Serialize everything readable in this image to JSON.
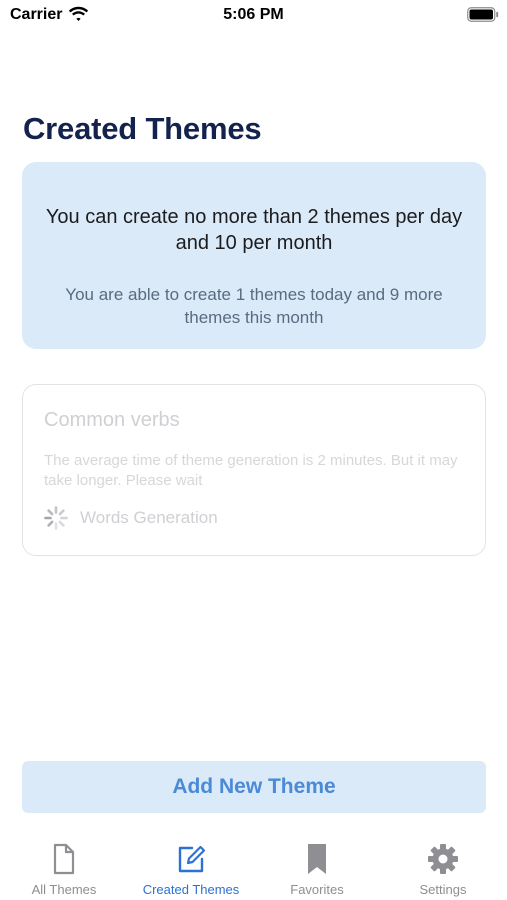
{
  "status_bar": {
    "carrier": "Carrier",
    "time": "5:06 PM",
    "icons": [
      "wifi-icon",
      "battery-icon"
    ]
  },
  "page": {
    "title": "Created Themes"
  },
  "info_card": {
    "main_text": "You can create no more than 2 themes per day and 10 per month",
    "sub_text": "You are able to create 1 themes today and 9 more themes this month"
  },
  "theme_card": {
    "name": "Common verbs",
    "description": "The average time of theme generation is 2 minutes. But it may take longer. Please wait",
    "status_label": "Words Generation",
    "status_icon": "spinner-icon"
  },
  "add_button": {
    "label": "Add New Theme"
  },
  "tab_bar": {
    "items": [
      {
        "label": "All Themes",
        "icon": "document-icon",
        "active": false
      },
      {
        "label": "Created Themes",
        "icon": "edit-icon",
        "active": true
      },
      {
        "label": "Favorites",
        "icon": "bookmark-icon",
        "active": false
      },
      {
        "label": "Settings",
        "icon": "gear-icon",
        "active": false
      }
    ]
  },
  "colors": {
    "title": "#14234d",
    "card_background": "#daeaf9",
    "accent": "#2d72d2",
    "button_text": "#4a8ad6",
    "inactive_tab": "#8e8e93"
  }
}
